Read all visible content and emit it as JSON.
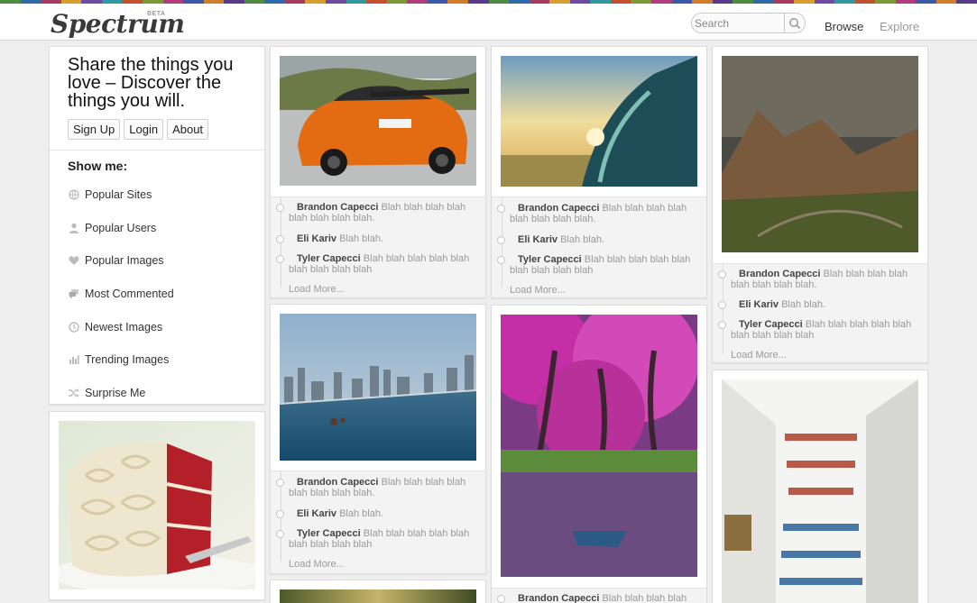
{
  "app": {
    "logo": "Spectrum",
    "beta": "BETA"
  },
  "search": {
    "placeholder": "Search",
    "value": ""
  },
  "nav": {
    "browse": "Browse",
    "explore": "Explore"
  },
  "intro": {
    "tagline": "Share the things you love – Discover the things you will.",
    "buttons": {
      "signup": "Sign Up",
      "login": "Login",
      "about": "About"
    },
    "showme": "Show me:",
    "menu": [
      {
        "label": "Popular Sites",
        "icon": "globe-icon"
      },
      {
        "label": "Popular Users",
        "icon": "user-icon"
      },
      {
        "label": "Popular Images",
        "icon": "heart-icon"
      },
      {
        "label": "Most Commented",
        "icon": "comments-icon"
      },
      {
        "label": "Newest Images",
        "icon": "clock-icon"
      },
      {
        "label": "Trending Images",
        "icon": "bar-chart-icon"
      },
      {
        "label": "Surprise Me",
        "icon": "shuffle-icon"
      }
    ]
  },
  "comments": {
    "c1_user": "Brandon Capecci",
    "c1_text": "Blah blah blah blah blah blah blah blah.",
    "c2_user": "Eli Kariv",
    "c2_text": "Blah blah.",
    "c3_user": "Tyler Capecci",
    "c3_text": "Blah blah blah blah blah blah blah blah blah",
    "load_more": "Load More..."
  },
  "images": [
    {
      "name": "orange-car-photo"
    },
    {
      "name": "ocean-wave-photo"
    },
    {
      "name": "mountain-valley-photo"
    },
    {
      "name": "infinity-pool-photo"
    },
    {
      "name": "pink-forest-photo"
    },
    {
      "name": "bookshelf-wall-photo"
    },
    {
      "name": "red-velvet-cake-photo"
    }
  ],
  "colors": {
    "accent_stripe": [
      "#4d8e3e",
      "#2f6aa8",
      "#a83a5e",
      "#d8a02a",
      "#6e4aa0",
      "#2e9aa0",
      "#c3502c",
      "#7a9a32",
      "#b43a7e",
      "#3a5aa8",
      "#d07e2a",
      "#5a3a8a"
    ]
  }
}
